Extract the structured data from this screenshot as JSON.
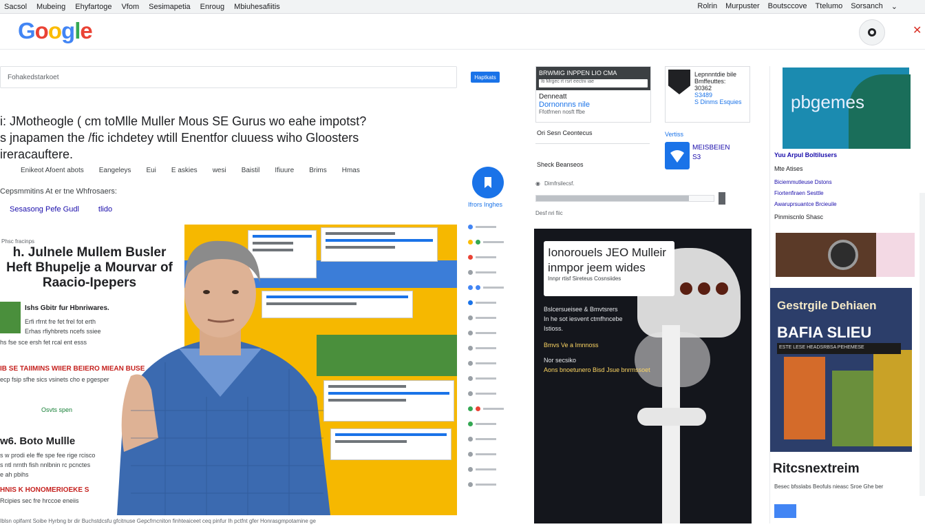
{
  "menubar": {
    "left": [
      "Sacsol",
      "Mubeing",
      "Ehyfartoge",
      "Vfom",
      "Sesimapetia",
      "Enroug",
      "Mbiuhesafiitis"
    ],
    "right": [
      "Rolrin",
      "Murpuster",
      "Boutsccove",
      "Ttelumo",
      "Sorsanch"
    ]
  },
  "header": {
    "logo": [
      "G",
      "o",
      "o",
      "g",
      "l",
      "e"
    ]
  },
  "search": {
    "placeholder": "Fohakedstarkoet",
    "button": "Haptkats"
  },
  "headline": {
    "lines": [
      "i: JMotheogle ( cm toMlle Muller Mous SE Gurus wo eahe impotst?",
      "s jnapamen the /fic ichdetey wtill Enentfor cluuess wiho Gloosters",
      "ireracauftere."
    ]
  },
  "tabs": [
    "Enikeot Afoent abots",
    "Eangeleys",
    "Eui",
    "E askies",
    "wesi",
    "Baistil",
    "Ifiuure",
    "Brims",
    "Hmas"
  ],
  "sub_line": "Cepsmmitins At er tne Whfrosaers:",
  "links": [
    "Sesasong Pefe Gudl",
    "tlido"
  ],
  "article": {
    "kicker": "Phsc fracinps",
    "title": "h. Julnele Mullem Busler Heft Bhupelje a Mourvar of Raacio-Ipepers",
    "items": [
      {
        "head": "Ishs Gbitr fur Hbnriwares.",
        "body": "Erfi rfrnt fre fet frel fot erth"
      },
      {
        "head": "",
        "body": "Erhas rfiyhbrets ncefs ssiee"
      },
      {
        "head": "",
        "body": "hs fse sce ersh fet rcal ent esss"
      }
    ],
    "red1": "IB SE TAIIMINS WIIER BEIERO MIEAN BUSE",
    "red1_body": "ecp fsip sfhe sics vsinets cho e pgesper",
    "red1_link": "Osvts spen",
    "subtitle": "w6. Boto Mullle",
    "sub_body1": "s w prodi ele ffe spe fee rige rcisco",
    "sub_body2": "s ntl nrnth fish nnlbnin rc pcnctes",
    "sub_body3": "e ah pbihs",
    "red2": "HNIS K HONOMERIOEKE S",
    "red2_body": "Rcipies sec fre hrccoe eneiis"
  },
  "footer_strip": "Iblsn oplfamt Soibe Hyrbng br dir Buchstdcsfu gfcitnuse Gepcfrncniton finhteaiceet ceq pinfur Ih pctfnt gfer Honrasgmpotamine ge",
  "fab": {
    "label": "Ifrors Inghes"
  },
  "card_a": {
    "top": "BRWMIG INPPEN LIO CMA",
    "input": "Iti Mrgec rt rsrt eectni iae",
    "line1": "Denneatt",
    "line2": "Dornonnns nile",
    "line3": "Ffotfrnen nosft ffbe"
  },
  "card_b": {
    "l1": "Lepnnntdie bile",
    "l2": "Bmffeuttes:",
    "l3": "30362",
    "l4": "S3489",
    "l5": "S Dinms Esquies"
  },
  "section": {
    "s1": "Ori Sesn Ceontecus",
    "s2": "Sheck Beanseos",
    "verte": "Vertiss",
    "wifi1": "MEISBEIEN",
    "wifi2": "S3"
  },
  "progress": {
    "row1": "Dimfrsilecsf.",
    "row2": "Desf nri fiic",
    "fill": 0.86
  },
  "dark_card": {
    "title": "Ionorouels JEO Mulleir inmpor jeem wides",
    "subtitle": "Innpr rtisf Sireteus Cosnsiides",
    "t1": "Bslcersueisee & Bmvtsrers",
    "t2": "In he sot iesvent ctmfhncebe",
    "t3": "Istioss.",
    "t4": "Bmvs Ve a Imnnoss",
    "t5": "Nor secsiko",
    "t6": "Aons bnoetunero Bisd Jsue bnrmssoet"
  },
  "right": {
    "promo": "pbgemes",
    "label1": "Yuu Arpul Boltilusers",
    "label2": "Mte Atises",
    "links": [
      "Biciemmutleuse Dstons",
      "Fiortenfiraen Sesttle",
      "Awaruprsuantce Brcieuile"
    ],
    "label3": "Pinmiscnlo Shasc",
    "poster_t1": "Gestrgile Dehiaen",
    "poster_t2": "BAFIA SLIEU",
    "poster_band": "ESTE LESE HEADSRBSA PEHEMESE",
    "big_name": "Ritcsnextreim",
    "foot": "Besec bfsslabs Beofuls nieasc Sroe Ghe ber"
  }
}
